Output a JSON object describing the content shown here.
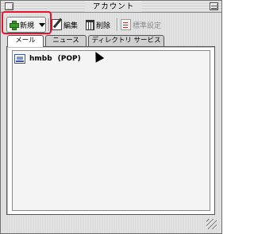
{
  "window": {
    "title": "アカウント"
  },
  "toolbar": {
    "new_label": "新規",
    "edit_label": "編集",
    "delete_label": "削除",
    "prefs_label": "標準設定"
  },
  "tabs": [
    {
      "label": "メール",
      "active": true
    },
    {
      "label": "ニュース",
      "active": false
    },
    {
      "label": "ディレクトリ サービス",
      "active": false
    }
  ],
  "accounts": [
    {
      "name": "hmbb",
      "protocol": "(POP)"
    }
  ],
  "colors": {
    "highlight": "#e8102a",
    "window_bg": "#dcdcdc",
    "list_bg": "#ffffff"
  }
}
